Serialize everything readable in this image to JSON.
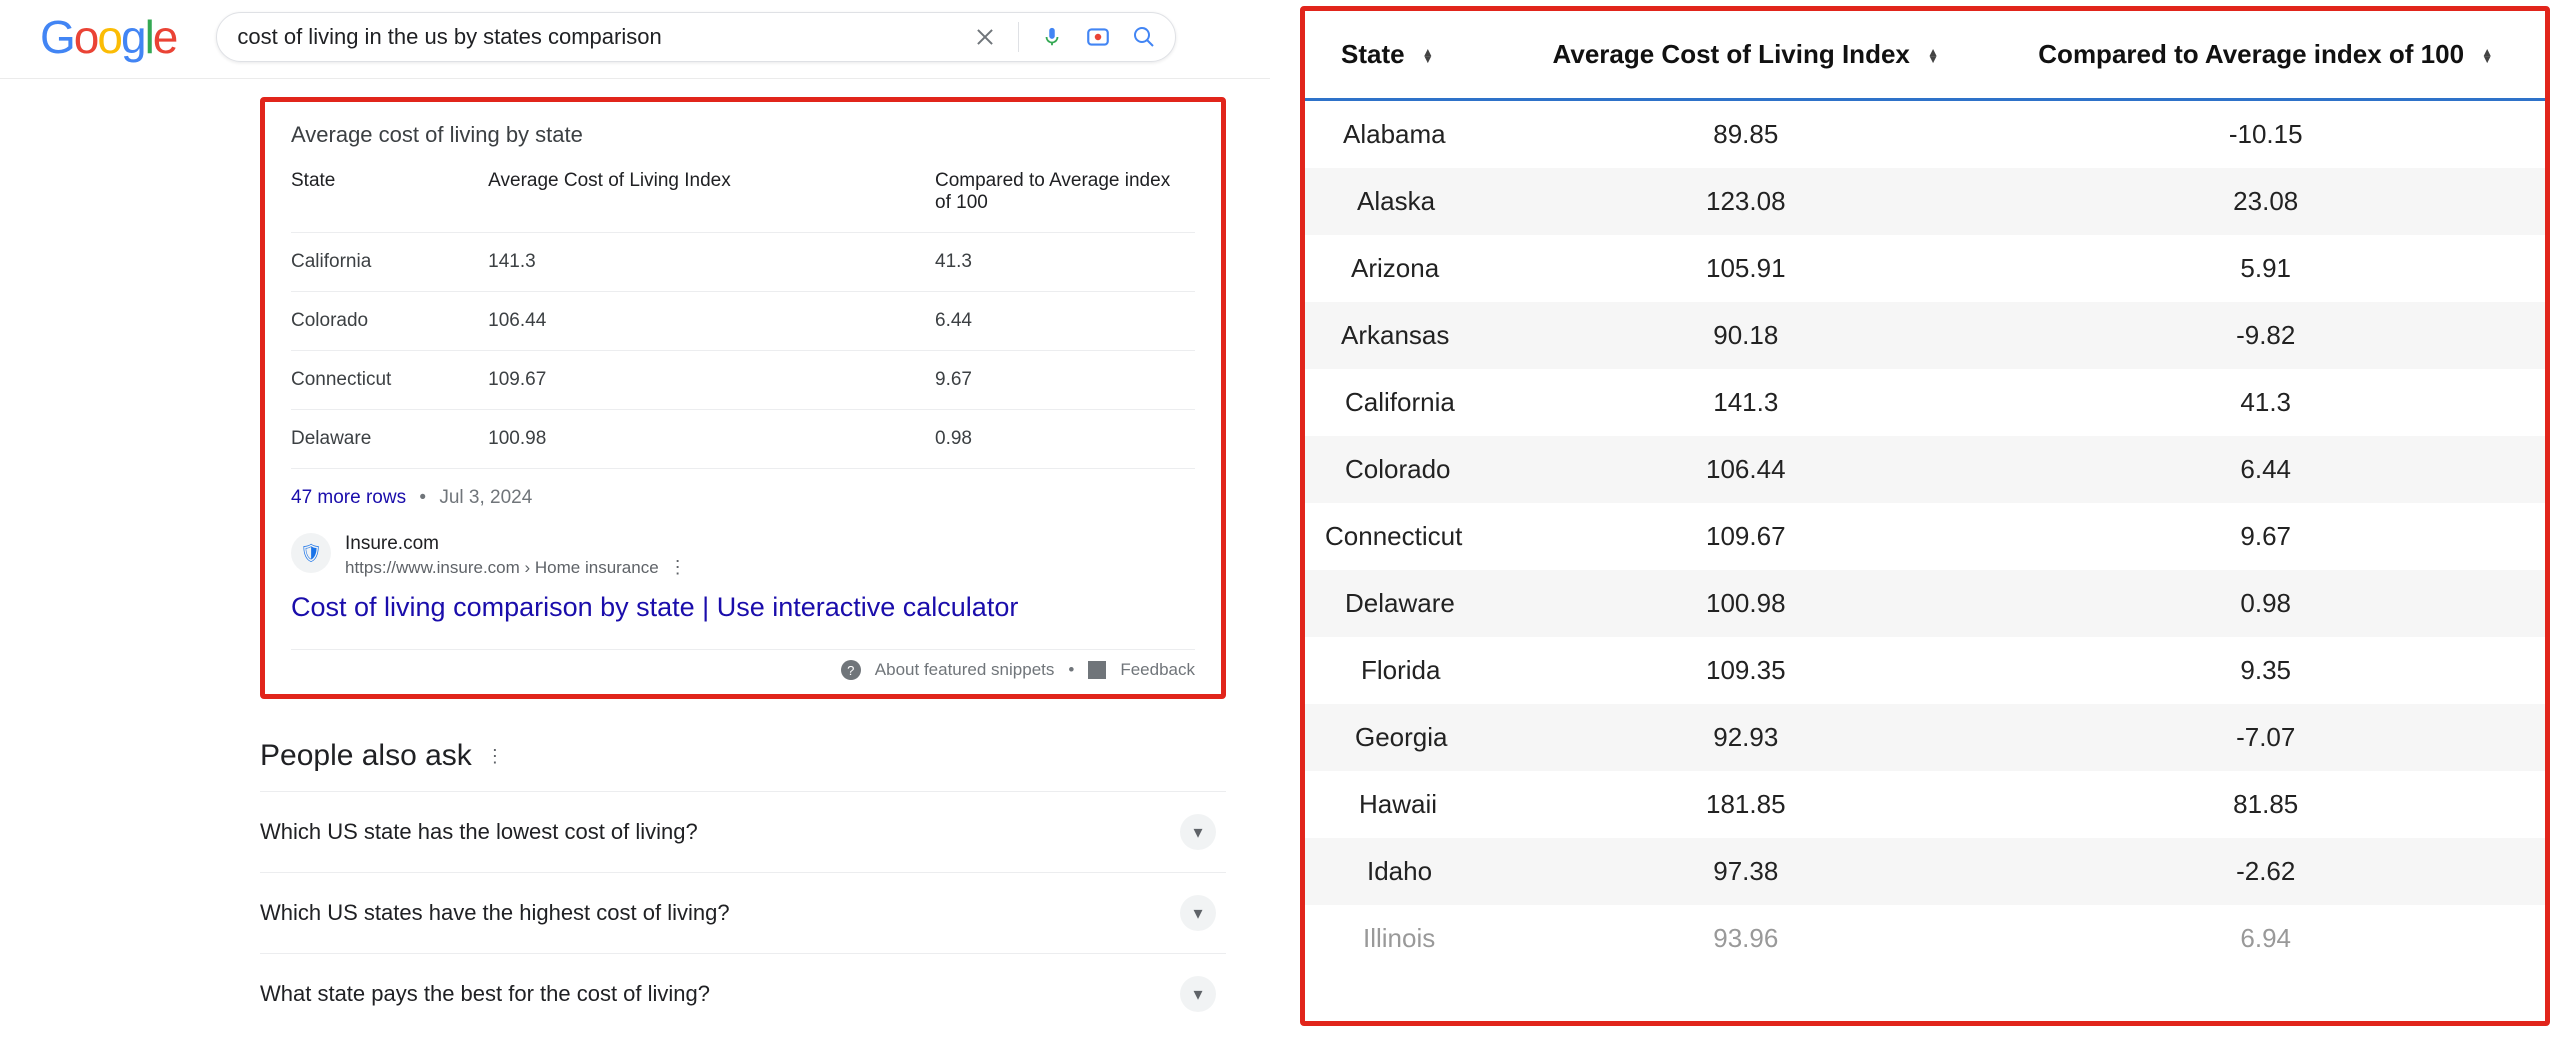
{
  "search": {
    "query": "cost of living in the us by states comparison"
  },
  "snippet": {
    "title": "Average cost of living by state",
    "columns": [
      "State",
      "Average Cost of Living Index",
      "Compared to Average index of 100"
    ],
    "rows": [
      {
        "state": "California",
        "index": "141.3",
        "diff": "41.3"
      },
      {
        "state": "Colorado",
        "index": "106.44",
        "diff": "6.44"
      },
      {
        "state": "Connecticut",
        "index": "109.67",
        "diff": "9.67"
      },
      {
        "state": "Delaware",
        "index": "100.98",
        "diff": "0.98"
      }
    ],
    "more_rows_text": "47 more rows",
    "date": "Jul 3, 2024",
    "source_name": "Insure.com",
    "source_url": "https://www.insure.com › Home insurance",
    "source_title_link": "Cost of living comparison by state | Use interactive calculator",
    "about_text": "About featured snippets",
    "feedback_text": "Feedback"
  },
  "paa": {
    "heading": "People also ask",
    "items": [
      "Which US state has the lowest cost of living?",
      "Which US states have the highest cost of living?",
      "What state pays the best for the cost of living?"
    ]
  },
  "big_table": {
    "columns": [
      "State",
      "Average Cost of Living Index",
      "Compared to Average index of 100"
    ],
    "rows": [
      {
        "state": "Alabama",
        "index": "89.85",
        "diff": "-10.15"
      },
      {
        "state": "Alaska",
        "index": "123.08",
        "diff": "23.08"
      },
      {
        "state": "Arizona",
        "index": "105.91",
        "diff": "5.91"
      },
      {
        "state": "Arkansas",
        "index": "90.18",
        "diff": "-9.82"
      },
      {
        "state": "California",
        "index": "141.3",
        "diff": "41.3"
      },
      {
        "state": "Colorado",
        "index": "106.44",
        "diff": "6.44"
      },
      {
        "state": "Connecticut",
        "index": "109.67",
        "diff": "9.67"
      },
      {
        "state": "Delaware",
        "index": "100.98",
        "diff": "0.98"
      },
      {
        "state": "Florida",
        "index": "109.35",
        "diff": "9.35"
      },
      {
        "state": "Georgia",
        "index": "92.93",
        "diff": "-7.07"
      },
      {
        "state": "Hawaii",
        "index": "181.85",
        "diff": "81.85"
      },
      {
        "state": "Idaho",
        "index": "97.38",
        "diff": "-2.62"
      }
    ],
    "cutoff_row": {
      "state": "Illinois",
      "index": "93.96",
      "diff": "6.94"
    }
  },
  "chart_data": {
    "type": "table",
    "title": "Average cost of living by state",
    "columns": [
      "State",
      "Average Cost of Living Index",
      "Compared to Average index of 100"
    ],
    "rows": [
      [
        "Alabama",
        89.85,
        -10.15
      ],
      [
        "Alaska",
        123.08,
        23.08
      ],
      [
        "Arizona",
        105.91,
        5.91
      ],
      [
        "Arkansas",
        90.18,
        -9.82
      ],
      [
        "California",
        141.3,
        41.3
      ],
      [
        "Colorado",
        106.44,
        6.44
      ],
      [
        "Connecticut",
        109.67,
        9.67
      ],
      [
        "Delaware",
        100.98,
        0.98
      ],
      [
        "Florida",
        109.35,
        9.35
      ],
      [
        "Georgia",
        92.93,
        -7.07
      ],
      [
        "Hawaii",
        181.85,
        81.85
      ],
      [
        "Idaho",
        97.38,
        -2.62
      ]
    ]
  }
}
